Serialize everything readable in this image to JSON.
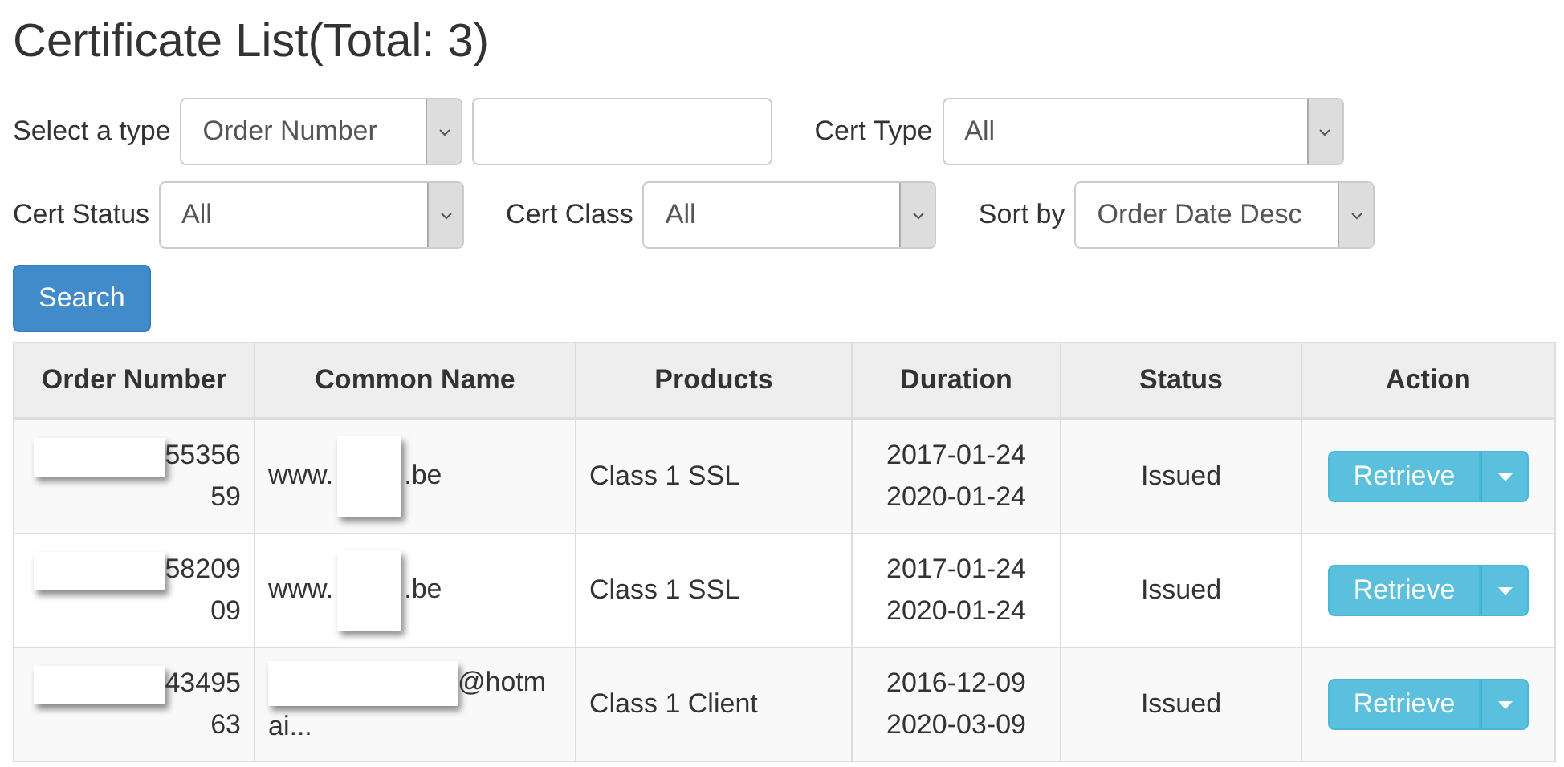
{
  "title": "Certificate List(Total: 3)",
  "filter_rows": [
    [
      {
        "kind": "select",
        "label": "Select a type",
        "value": "Order Number"
      },
      {
        "kind": "input"
      },
      {
        "kind": "select",
        "label": "Cert Type",
        "value": "All"
      }
    ],
    [
      {
        "kind": "select",
        "label": "Cert Status",
        "value": "All"
      },
      {
        "kind": "select",
        "label": "Cert Class",
        "value": "All"
      },
      {
        "kind": "select",
        "label": "Sort by",
        "value": "Order Date Desc"
      }
    ]
  ],
  "search_button": "Search",
  "table": {
    "columns": [
      "Order Number",
      "Common Name",
      "Products",
      "Duration",
      "Status",
      "Action"
    ],
    "rows": [
      {
        "order_number": [
          {
            "kind": "redacted"
          },
          {
            "kind": "text",
            "text": "55356"
          },
          {
            "kind": "break"
          },
          {
            "kind": "text",
            "text": "59"
          }
        ],
        "common_name": [
          {
            "kind": "text",
            "text": "www."
          },
          {
            "kind": "redacted"
          },
          {
            "kind": "text",
            "text": ".be"
          }
        ],
        "product": "Class 1 SSL",
        "duration": [
          "2017-01-24",
          "2020-01-24"
        ],
        "status": "Issued",
        "action": "Retrieve"
      },
      {
        "order_number": [
          {
            "kind": "redacted"
          },
          {
            "kind": "text",
            "text": "58209"
          },
          {
            "kind": "break"
          },
          {
            "kind": "text",
            "text": "09"
          }
        ],
        "common_name": [
          {
            "kind": "text",
            "text": "www."
          },
          {
            "kind": "redacted"
          },
          {
            "kind": "text",
            "text": ".be"
          }
        ],
        "product": "Class 1 SSL",
        "duration": [
          "2017-01-24",
          "2020-01-24"
        ],
        "status": "Issued",
        "action": "Retrieve"
      },
      {
        "order_number": [
          {
            "kind": "redacted"
          },
          {
            "kind": "text",
            "text": "43495"
          },
          {
            "kind": "break"
          },
          {
            "kind": "text",
            "text": "63"
          }
        ],
        "common_name": [
          {
            "kind": "redacted"
          },
          {
            "kind": "text",
            "text": "@hotm"
          },
          {
            "kind": "break"
          },
          {
            "kind": "text",
            "text": "ai..."
          }
        ],
        "product": "Class 1 Client",
        "duration": [
          "2016-12-09",
          "2020-03-09"
        ],
        "status": "Issued",
        "action": "Retrieve"
      }
    ]
  }
}
